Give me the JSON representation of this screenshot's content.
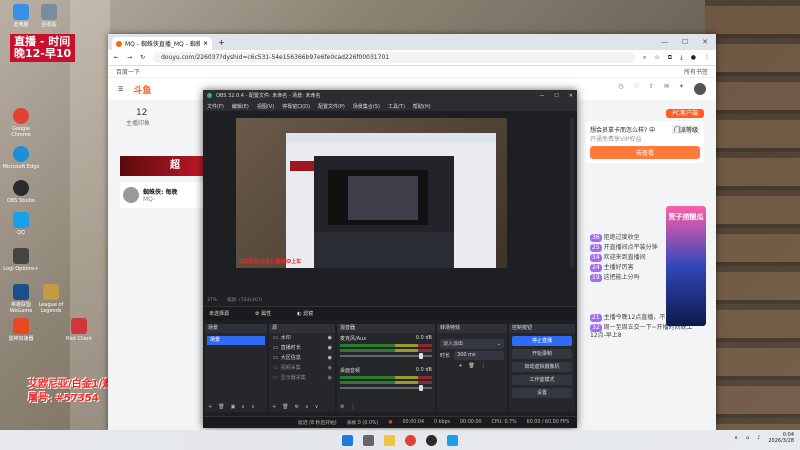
{
  "desktop": {
    "icons": [
      {
        "label": "此电脑",
        "color": "#3a8ee6"
      },
      {
        "label": "回收站",
        "color": "#7a8c9e"
      },
      {
        "label": "Google Chrome",
        "color": "#e34133"
      },
      {
        "label": "Microsoft Edge",
        "color": "#1e8fd6"
      },
      {
        "label": "OBS Studio",
        "color": "#2b2b2b"
      },
      {
        "label": "QQ",
        "color": "#1aa0ea"
      },
      {
        "label": "Logi Options+",
        "color": "#444444"
      },
      {
        "label": "英雄联盟WeGame",
        "color": "#1b4f8a"
      },
      {
        "label": "League of Legends",
        "color": "#c49a45"
      },
      {
        "label": "雷神加速器",
        "color": "#e8481e"
      },
      {
        "label": "Riot Client",
        "color": "#d13639"
      }
    ],
    "overlay_top": {
      "line1": "直播 - 时间",
      "line2": "晚12-早10"
    },
    "overlay_bottom": {
      "line1": "艾欧尼亚/白金1/邀请ID上车",
      "line2": "屠号: #57354"
    }
  },
  "browser": {
    "tab_title": "MQ - 蜘蛛侠直播_MQ - 蜘蛛侠视频",
    "new_tab": "+",
    "url": "douyu.com/226037?dyshid=c6c531-54e156366b97e6fe0cad226f00031701",
    "bookmark": "百度一下",
    "bookmark_right": "所有书签"
  },
  "douyu": {
    "logo": "斗鱼",
    "follow_count": "12",
    "follow_label": "主播印象",
    "streamer_name": "蜘蛛侠: 每晚",
    "streamer_sub": "MQ-",
    "banner_text": "超",
    "pc_client": "PC客户端",
    "side_title": "想会员拿卡而怎么样? 中",
    "side_badge": "门派等级",
    "side_sub": "开通免费享VIP权益",
    "side_btn": "去查看",
    "promo_title": "荒子捞酸瓜",
    "chat": [
      {
        "lv": "36",
        "text": "拒绝过度收坐"
      },
      {
        "lv": "25",
        "text": "开直播间点平装分钟"
      },
      {
        "lv": "34",
        "text": "欢迎来到直播间"
      },
      {
        "lv": "24",
        "text": "主播好厉害"
      },
      {
        "lv": "19",
        "text": "这把能上分吗"
      },
      {
        "lv": "21",
        "text": "主播今晚12点直播，不见不散！"
      },
      {
        "lv": "32",
        "text": "周一至周五交一下~开播时间晚上12点-早上8"
      }
    ]
  },
  "obs": {
    "title": "OBS 32.0.4 - 配置文件: 未命名 - 场景: 未命名",
    "menu": [
      "文件(F)",
      "编辑(E)",
      "视图(V)",
      "停靠窗口(D)",
      "配置文件(P)",
      "场景集合(S)",
      "工具(T)",
      "帮助(H)"
    ],
    "zoom_text": "37%",
    "resolution_text": "缩放: (724x407)",
    "no_source": "未选择源",
    "properties": "属性",
    "filters": "滤镜",
    "docks": {
      "scenes": {
        "title": "场景",
        "items": [
          "场景"
        ]
      },
      "sources": {
        "title": "源",
        "items": [
          "水印",
          "直播时长",
          "大区信息",
          "视频采集",
          "显示器采集"
        ]
      },
      "mixer": {
        "title": "混音器",
        "channels": [
          {
            "name": "麦克风/Aux",
            "db": "0.0 dB"
          },
          {
            "name": "桌面音频",
            "db": "0.0 dB"
          }
        ]
      },
      "transitions": {
        "title": "转场特效",
        "type": "淡入淡出",
        "duration_label": "时长",
        "duration": "300 ms"
      },
      "controls": {
        "title": "控制按钮",
        "buttons": [
          "停止直播",
          "开始录制",
          "启动虚拟摄像机",
          "工作室模式",
          "设置"
        ]
      }
    },
    "status": {
      "dropped": "延迟 (8 秒后开始)",
      "frames": "丢帧 0 (0.0%)",
      "live": "00:00:04",
      "cpu": "CPU: 0.7%",
      "fps": "60.00 / 60.00 FPS",
      "kbps": "0 kbps",
      "rec": "00:00:00"
    }
  },
  "taskbar": {
    "clock_time": "0:04",
    "clock_date": "2026/3/28"
  }
}
